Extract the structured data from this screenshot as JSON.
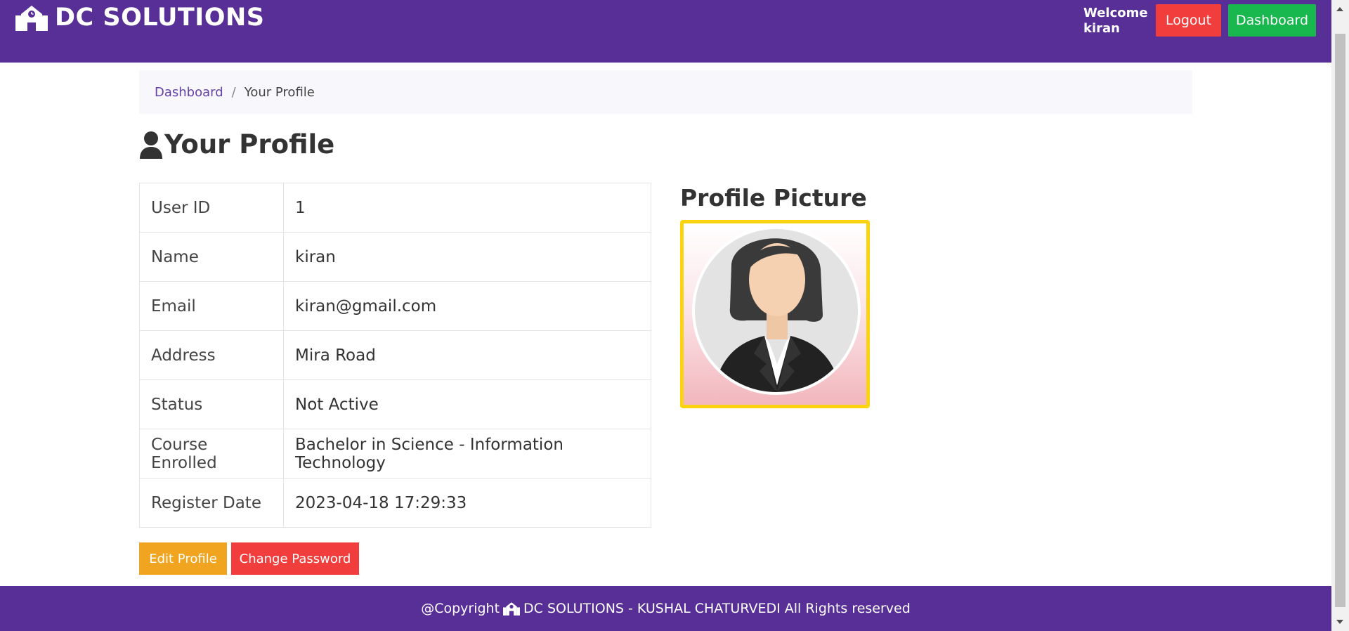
{
  "header": {
    "brand": "DC SOLUTIONS",
    "welcome": "Welcome kiran",
    "logout_label": "Logout",
    "dashboard_label": "Dashboard"
  },
  "breadcrumb": {
    "link": "Dashboard",
    "separator": "/",
    "active": "Your Profile"
  },
  "page_title": "Your Profile",
  "profile_rows": [
    {
      "label": "User ID",
      "value": "1"
    },
    {
      "label": "Name",
      "value": "kiran"
    },
    {
      "label": "Email",
      "value": "kiran@gmail.com"
    },
    {
      "label": "Address",
      "value": "Mira Road"
    },
    {
      "label": "Status",
      "value": "Not Active"
    },
    {
      "label": "Course Enrolled",
      "value": "Bachelor in Science - Information Technology"
    },
    {
      "label": "Register Date",
      "value": "2023-04-18 17:29:33"
    }
  ],
  "actions": {
    "edit_label": "Edit Profile",
    "password_label": "Change Password"
  },
  "profile_picture": {
    "title": "Profile Picture",
    "frame_color": "#fbd40f"
  },
  "footer": {
    "prefix": "@Copyright",
    "text": "DC SOLUTIONS - KUSHAL CHATURVEDI All Rights reserved"
  },
  "colors": {
    "primary": "#572f96",
    "logout": "#f23d3d",
    "dashboard": "#18b84e",
    "edit": "#f0a420"
  }
}
